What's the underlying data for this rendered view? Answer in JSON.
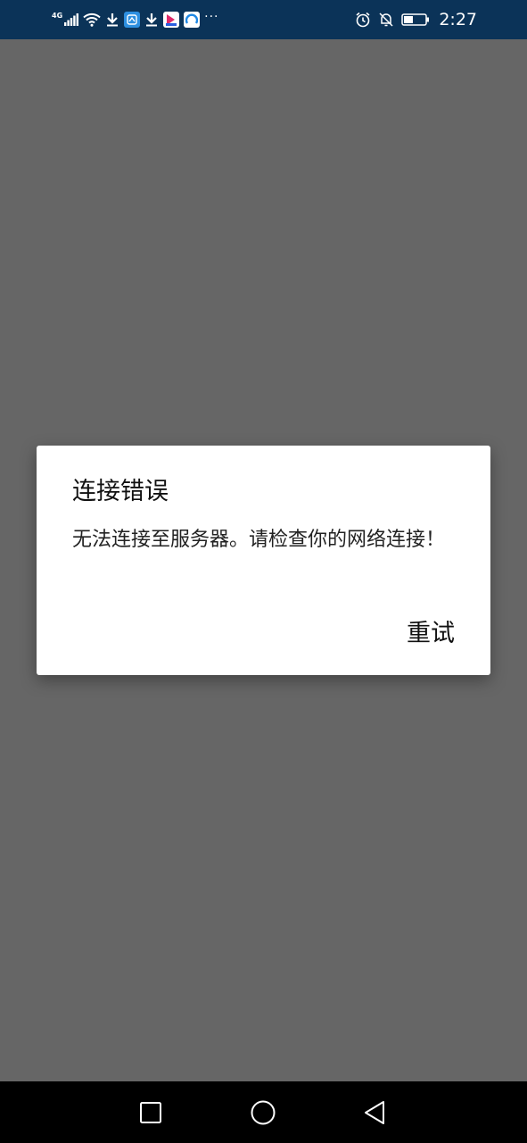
{
  "status_bar": {
    "network_type": "4G",
    "time": "2:27",
    "left_icons": [
      "signal-icon",
      "wifi-icon",
      "download-icon",
      "app-notification-icon",
      "download-icon",
      "app-notification-icon",
      "app-notification-icon",
      "more-notifications-icon"
    ],
    "right_icons": [
      "alarm-icon",
      "mute-icon",
      "battery-icon"
    ],
    "colors": {
      "background": "#0b3358",
      "foreground": "#ffffff"
    }
  },
  "dialog": {
    "title": "连接错误",
    "message": "无法连接至服务器。请检查你的网络连接！",
    "retry_label": "重试"
  },
  "nav_bar": {
    "buttons": [
      "recents-button",
      "home-button",
      "back-button"
    ]
  },
  "colors": {
    "scrim": "#666666",
    "dialog_bg": "#ffffff",
    "nav_bg": "#000000"
  }
}
